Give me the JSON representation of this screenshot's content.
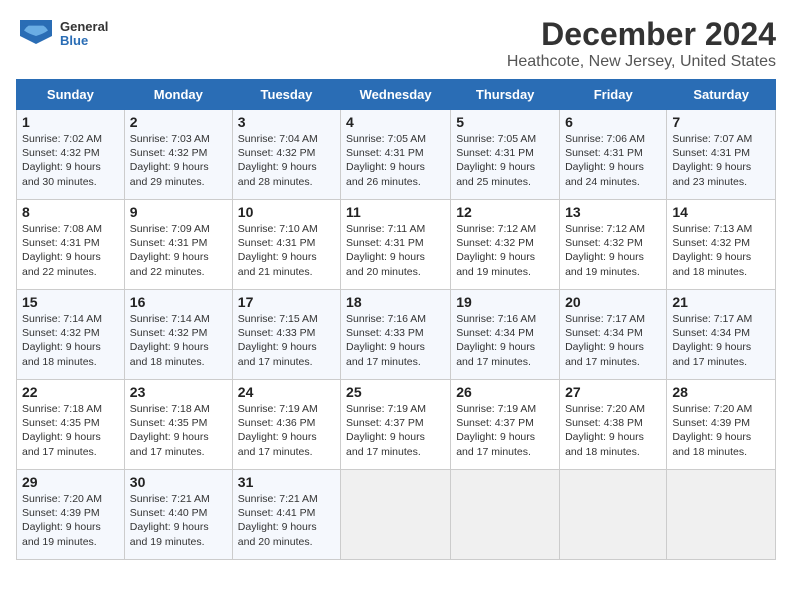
{
  "logo": {
    "general": "General",
    "blue": "Blue"
  },
  "title": "December 2024",
  "location": "Heathcote, New Jersey, United States",
  "days_of_week": [
    "Sunday",
    "Monday",
    "Tuesday",
    "Wednesday",
    "Thursday",
    "Friday",
    "Saturday"
  ],
  "weeks": [
    [
      {
        "day": "1",
        "sunrise": "7:02 AM",
        "sunset": "4:32 PM",
        "daylight": "9 hours and 30 minutes."
      },
      {
        "day": "2",
        "sunrise": "7:03 AM",
        "sunset": "4:32 PM",
        "daylight": "9 hours and 29 minutes."
      },
      {
        "day": "3",
        "sunrise": "7:04 AM",
        "sunset": "4:32 PM",
        "daylight": "9 hours and 28 minutes."
      },
      {
        "day": "4",
        "sunrise": "7:05 AM",
        "sunset": "4:31 PM",
        "daylight": "9 hours and 26 minutes."
      },
      {
        "day": "5",
        "sunrise": "7:05 AM",
        "sunset": "4:31 PM",
        "daylight": "9 hours and 25 minutes."
      },
      {
        "day": "6",
        "sunrise": "7:06 AM",
        "sunset": "4:31 PM",
        "daylight": "9 hours and 24 minutes."
      },
      {
        "day": "7",
        "sunrise": "7:07 AM",
        "sunset": "4:31 PM",
        "daylight": "9 hours and 23 minutes."
      }
    ],
    [
      {
        "day": "8",
        "sunrise": "7:08 AM",
        "sunset": "4:31 PM",
        "daylight": "9 hours and 22 minutes."
      },
      {
        "day": "9",
        "sunrise": "7:09 AM",
        "sunset": "4:31 PM",
        "daylight": "9 hours and 22 minutes."
      },
      {
        "day": "10",
        "sunrise": "7:10 AM",
        "sunset": "4:31 PM",
        "daylight": "9 hours and 21 minutes."
      },
      {
        "day": "11",
        "sunrise": "7:11 AM",
        "sunset": "4:31 PM",
        "daylight": "9 hours and 20 minutes."
      },
      {
        "day": "12",
        "sunrise": "7:12 AM",
        "sunset": "4:32 PM",
        "daylight": "9 hours and 19 minutes."
      },
      {
        "day": "13",
        "sunrise": "7:12 AM",
        "sunset": "4:32 PM",
        "daylight": "9 hours and 19 minutes."
      },
      {
        "day": "14",
        "sunrise": "7:13 AM",
        "sunset": "4:32 PM",
        "daylight": "9 hours and 18 minutes."
      }
    ],
    [
      {
        "day": "15",
        "sunrise": "7:14 AM",
        "sunset": "4:32 PM",
        "daylight": "9 hours and 18 minutes."
      },
      {
        "day": "16",
        "sunrise": "7:14 AM",
        "sunset": "4:32 PM",
        "daylight": "9 hours and 18 minutes."
      },
      {
        "day": "17",
        "sunrise": "7:15 AM",
        "sunset": "4:33 PM",
        "daylight": "9 hours and 17 minutes."
      },
      {
        "day": "18",
        "sunrise": "7:16 AM",
        "sunset": "4:33 PM",
        "daylight": "9 hours and 17 minutes."
      },
      {
        "day": "19",
        "sunrise": "7:16 AM",
        "sunset": "4:34 PM",
        "daylight": "9 hours and 17 minutes."
      },
      {
        "day": "20",
        "sunrise": "7:17 AM",
        "sunset": "4:34 PM",
        "daylight": "9 hours and 17 minutes."
      },
      {
        "day": "21",
        "sunrise": "7:17 AM",
        "sunset": "4:34 PM",
        "daylight": "9 hours and 17 minutes."
      }
    ],
    [
      {
        "day": "22",
        "sunrise": "7:18 AM",
        "sunset": "4:35 PM",
        "daylight": "9 hours and 17 minutes."
      },
      {
        "day": "23",
        "sunrise": "7:18 AM",
        "sunset": "4:35 PM",
        "daylight": "9 hours and 17 minutes."
      },
      {
        "day": "24",
        "sunrise": "7:19 AM",
        "sunset": "4:36 PM",
        "daylight": "9 hours and 17 minutes."
      },
      {
        "day": "25",
        "sunrise": "7:19 AM",
        "sunset": "4:37 PM",
        "daylight": "9 hours and 17 minutes."
      },
      {
        "day": "26",
        "sunrise": "7:19 AM",
        "sunset": "4:37 PM",
        "daylight": "9 hours and 17 minutes."
      },
      {
        "day": "27",
        "sunrise": "7:20 AM",
        "sunset": "4:38 PM",
        "daylight": "9 hours and 18 minutes."
      },
      {
        "day": "28",
        "sunrise": "7:20 AM",
        "sunset": "4:39 PM",
        "daylight": "9 hours and 18 minutes."
      }
    ],
    [
      {
        "day": "29",
        "sunrise": "7:20 AM",
        "sunset": "4:39 PM",
        "daylight": "9 hours and 19 minutes."
      },
      {
        "day": "30",
        "sunrise": "7:21 AM",
        "sunset": "4:40 PM",
        "daylight": "9 hours and 19 minutes."
      },
      {
        "day": "31",
        "sunrise": "7:21 AM",
        "sunset": "4:41 PM",
        "daylight": "9 hours and 20 minutes."
      },
      null,
      null,
      null,
      null
    ]
  ],
  "labels": {
    "sunrise": "Sunrise:",
    "sunset": "Sunset:",
    "daylight": "Daylight:"
  }
}
